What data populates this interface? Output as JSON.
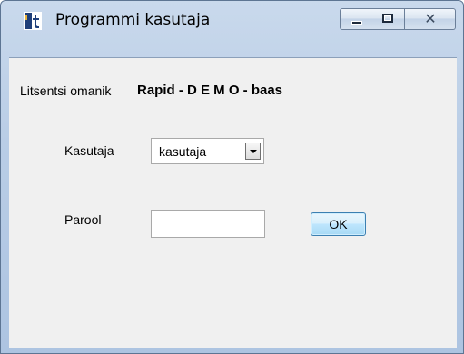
{
  "window": {
    "title": "Programmi kasutaja",
    "icon": "app-logo-icon",
    "close_glyph": "✕"
  },
  "license": {
    "label": "Litsentsi omanik",
    "value": "Rapid - D E M O - baas"
  },
  "user": {
    "label": "Kasutaja",
    "selected": "kasutaja"
  },
  "password": {
    "label": "Parool",
    "value": ""
  },
  "ok_button": {
    "label": "OK"
  },
  "colors": {
    "frame": "#b9cde6",
    "client": "#f0f0f0",
    "ok_accent": "#3c7fb1"
  }
}
